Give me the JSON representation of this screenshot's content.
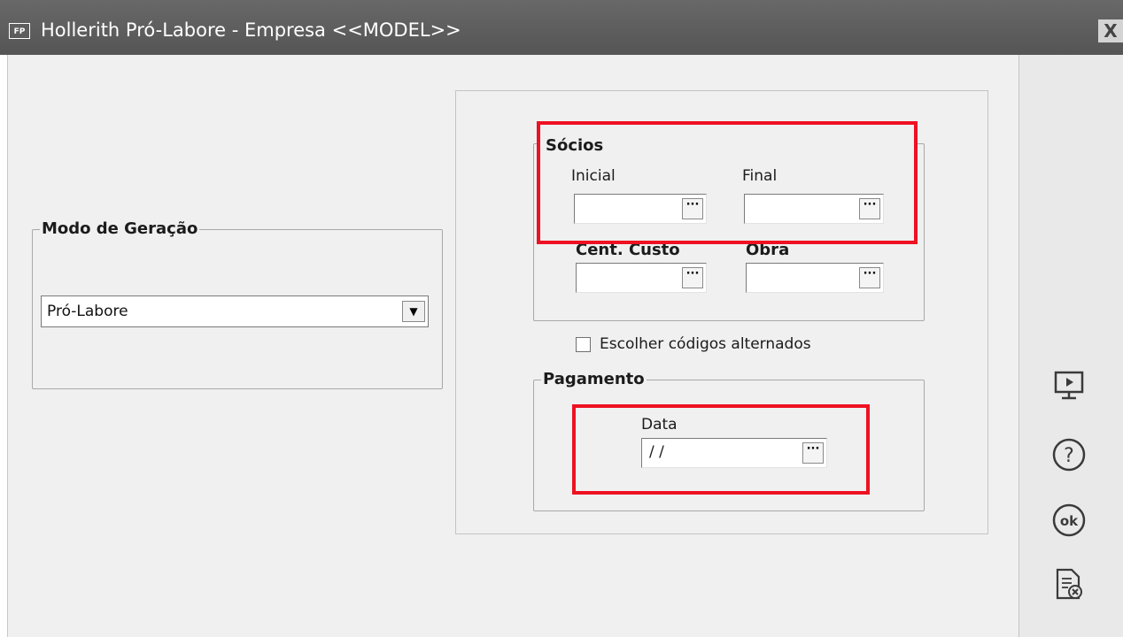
{
  "window": {
    "app_icon_label": "FP",
    "title": "Hollerith Pró-Labore - Empresa <<MODEL>>",
    "close_label": "X"
  },
  "modo_geracao": {
    "legend": "Modo de Geração",
    "selected": "Pró-Labore"
  },
  "socios": {
    "legend": "Sócios",
    "inicial_label": "Inicial",
    "inicial_value": "",
    "final_label": "Final",
    "final_value": "",
    "dots": "···"
  },
  "cent_custo": {
    "label": "Cent. Custo",
    "value": ""
  },
  "obra": {
    "label": "Obra",
    "value": ""
  },
  "codigos_alternados": {
    "label": "Escolher códigos alternados",
    "checked": false
  },
  "pagamento": {
    "legend": "Pagamento",
    "data_label": "Data",
    "data_value": "/ /"
  },
  "toolbar_icons": [
    "presentation-icon",
    "help-icon",
    "ok-icon",
    "cancel-document-icon"
  ],
  "colors": {
    "titlebar": "#5d5d5d",
    "highlight": "#ee1122",
    "client_bg": "#f0f0f0"
  }
}
